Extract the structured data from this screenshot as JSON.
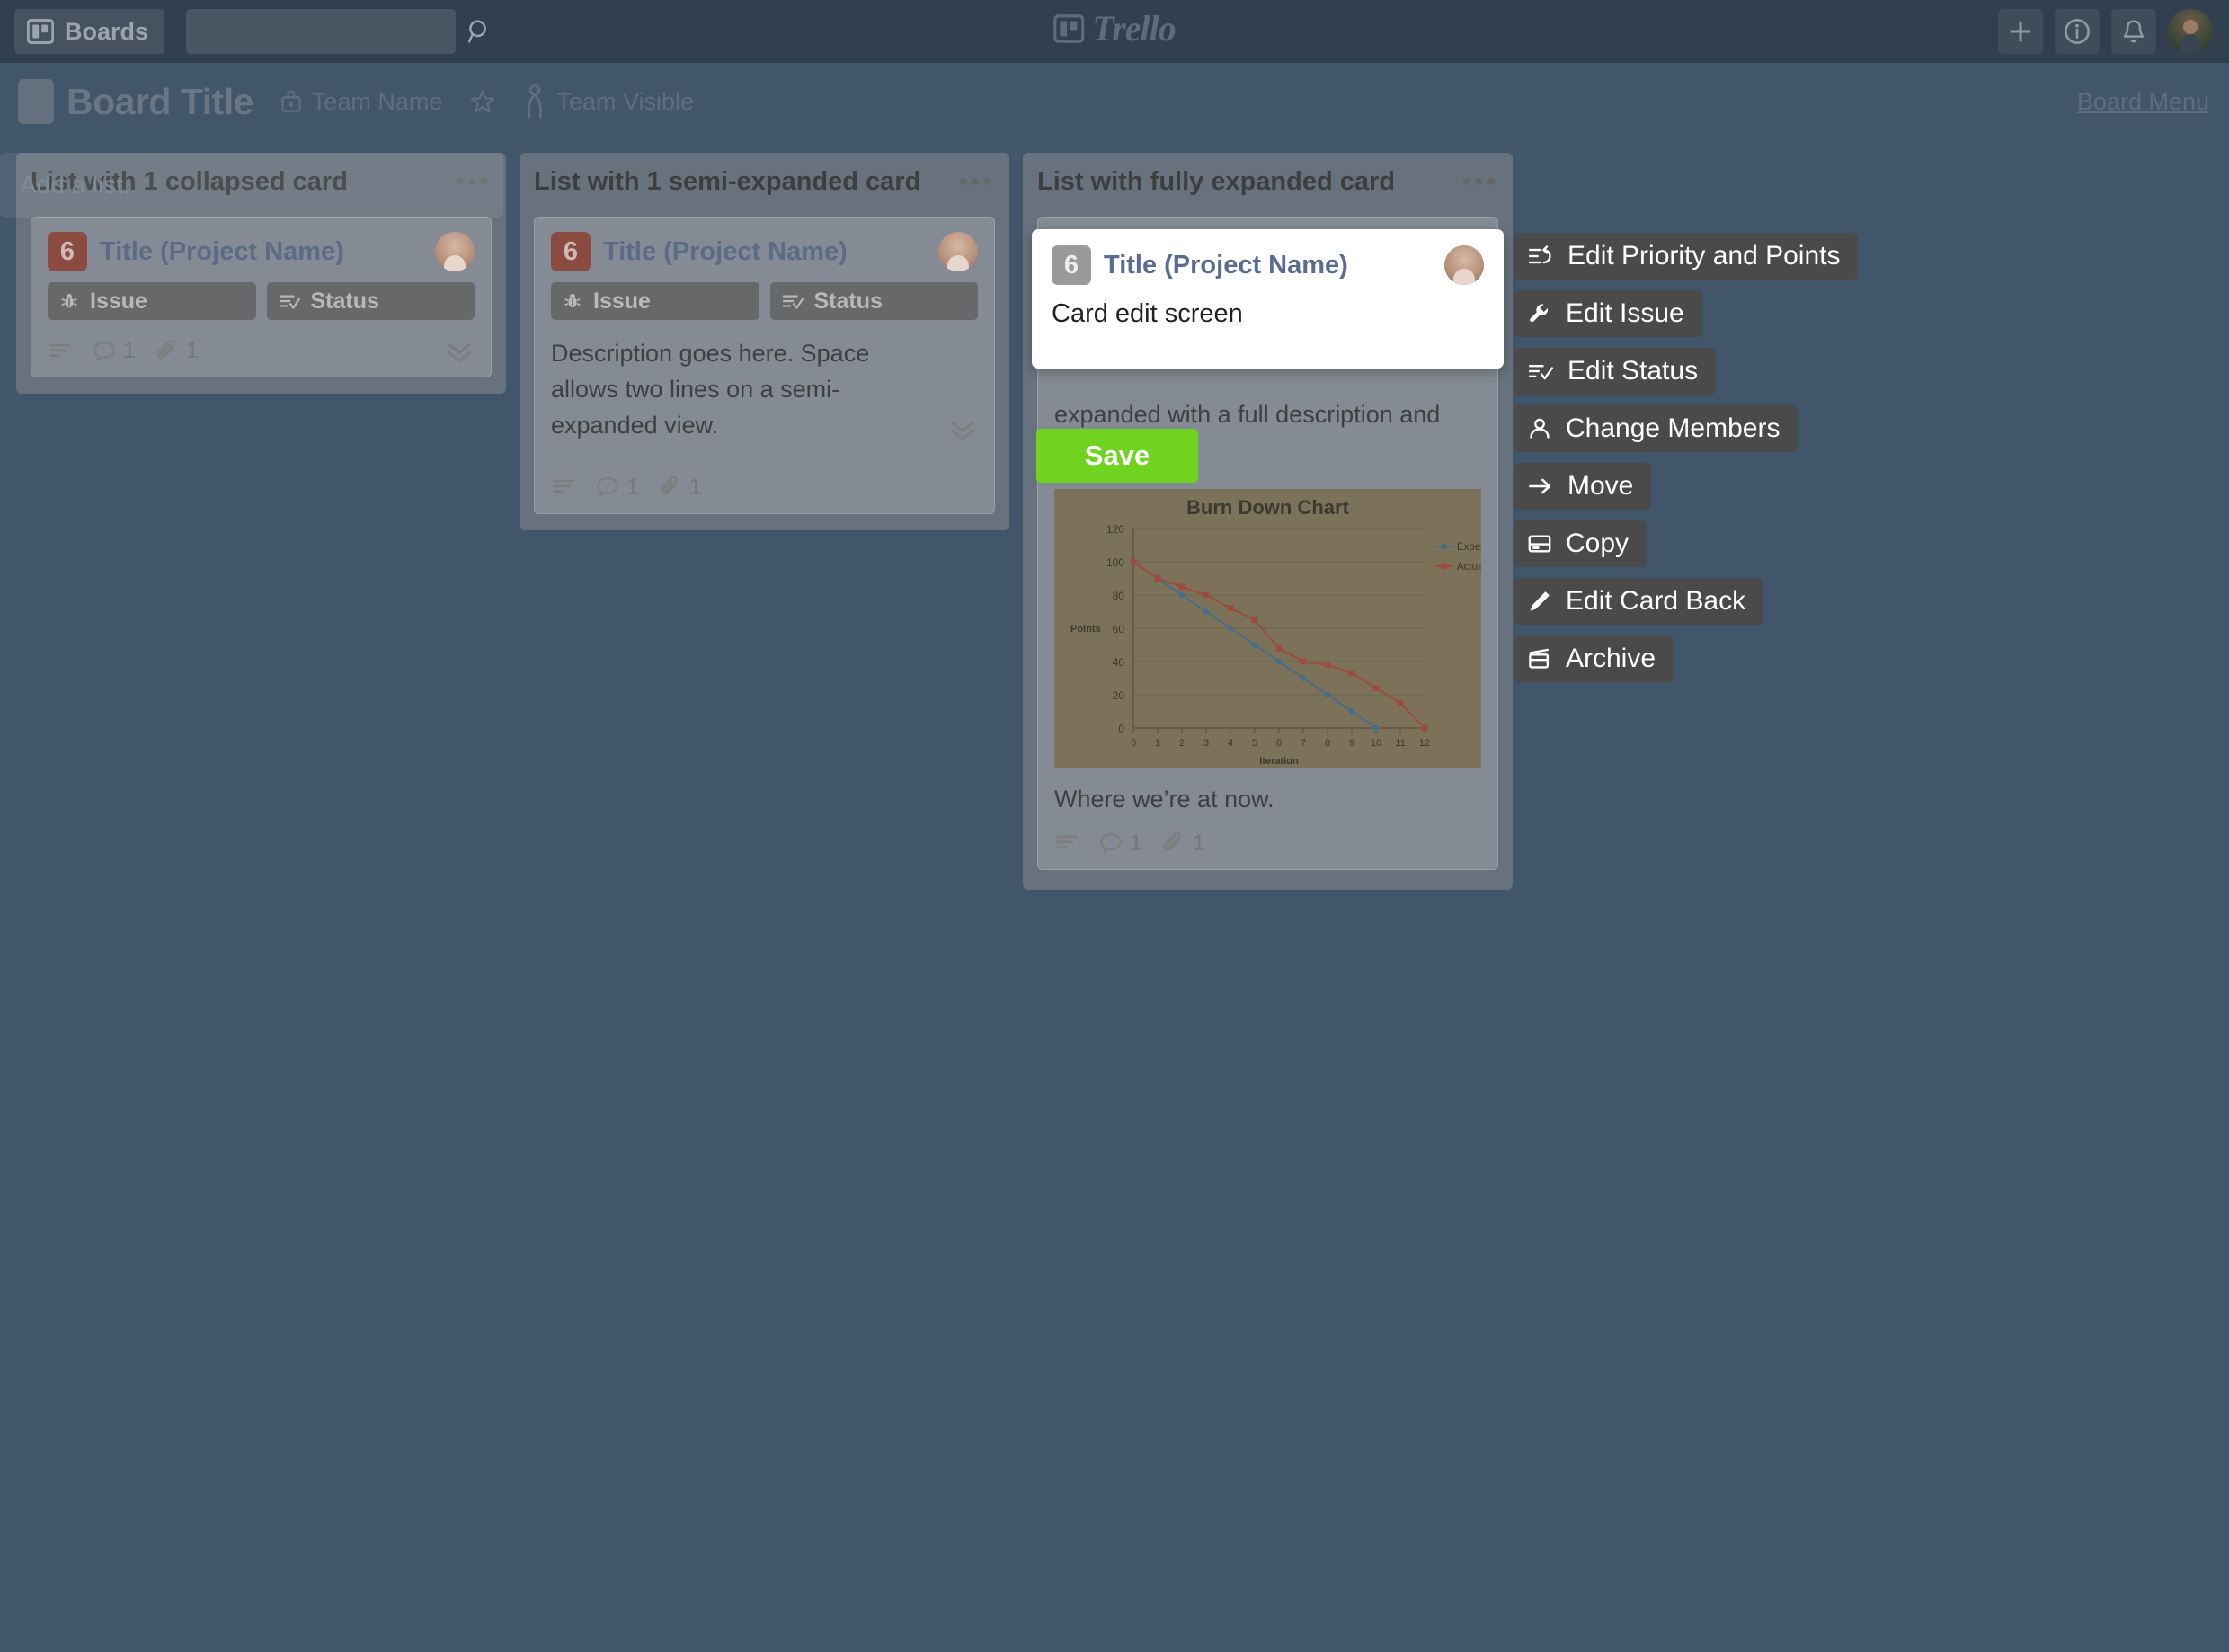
{
  "topbar": {
    "boards_label": "Boards",
    "search_placeholder": "",
    "search_value": "",
    "search_icon": "search-icon",
    "logo_text": "Trello",
    "icons": [
      "plus-icon",
      "info-icon",
      "bell-icon",
      "avatar"
    ]
  },
  "board_header": {
    "title": "Board Title",
    "team_name": "Team Name",
    "team_name_icon": "briefcase-lock-icon",
    "star_icon": "star-icon",
    "visibility": "Team Visible",
    "visibility_icon": "person-visible-icon",
    "board_menu": "Board Menu"
  },
  "lists": [
    {
      "title": "List with 1 collapsed card",
      "menu_icon": "ellipsis-icon",
      "card": {
        "points": "6",
        "title": "Title (Project Name)",
        "labels": [
          {
            "text": "Issue",
            "icon": "bug-icon"
          },
          {
            "text": "Status",
            "icon": "status-list-icon"
          }
        ],
        "description": "",
        "footer": {
          "description_icon": "description-icon",
          "comment_icon": "comment-icon",
          "comment_count": "1",
          "attachment_icon": "paperclip-icon",
          "attachment_count": "1",
          "expand_icon": "double-chevron-down-icon"
        }
      }
    },
    {
      "title": "List with 1 semi-expanded card",
      "menu_icon": "ellipsis-icon",
      "card": {
        "points": "6",
        "title": "Title (Project Name)",
        "labels": [
          {
            "text": "Issue",
            "icon": "bug-icon"
          },
          {
            "text": "Status",
            "icon": "status-list-icon"
          }
        ],
        "description": "Description goes here. Space allows two lines on a semi-expanded view.",
        "expand_icon": "double-chevron-down-icon",
        "footer": {
          "description_icon": "description-icon",
          "comment_icon": "comment-icon",
          "comment_count": "1",
          "attachment_icon": "paperclip-icon",
          "attachment_count": "1"
        }
      }
    },
    {
      "title": "List with fully expanded card",
      "menu_icon": "ellipsis-icon",
      "card": {
        "points": "6",
        "title": "Title (Project Name)",
        "description": "expanded with a full description and attachments.",
        "attachment_caption": "Where we’re at now.",
        "footer": {
          "description_icon": "description-icon",
          "comment_icon": "comment-icon",
          "comment_count": "1",
          "attachment_icon": "paperclip-icon",
          "attachment_count": "1"
        }
      }
    }
  ],
  "add_list": {
    "placeholder": "Add a list..."
  },
  "edit_overlay": {
    "points": "6",
    "title": "Title (Project Name)",
    "body_text": "Card edit screen",
    "save_label": "Save"
  },
  "context_menu": [
    {
      "label": "Edit Priority and Points",
      "icon": "priority-points-icon"
    },
    {
      "label": "Edit Issue",
      "icon": "wrench-icon"
    },
    {
      "label": "Edit Status",
      "icon": "status-list-icon"
    },
    {
      "label": "Change Members",
      "icon": "person-icon"
    },
    {
      "label": "Move",
      "icon": "arrow-right-icon"
    },
    {
      "label": "Copy",
      "icon": "copy-card-icon"
    },
    {
      "label": "Edit Card Back",
      "icon": "pencil-icon"
    },
    {
      "label": "Archive",
      "icon": "archive-box-icon"
    }
  ],
  "colors": {
    "board_background": "#41556b",
    "topbar": "#313f4e",
    "save_button": "#6fd320",
    "points_badge": "#8b4b41",
    "card_title": "#5c6b85",
    "chart_background": "#7c7259",
    "expected_series": "#4a6c86",
    "actual_series": "#9e4a3f"
  },
  "chart_data": {
    "type": "line",
    "title": "Burn Down Chart",
    "xlabel": "Iteration",
    "ylabel": "Points",
    "x": [
      0,
      1,
      2,
      3,
      4,
      5,
      6,
      7,
      8,
      9,
      10,
      11,
      12
    ],
    "xticks": [
      "0",
      "1",
      "2",
      "3",
      "4",
      "5",
      "6",
      "7",
      "8",
      "9",
      "10",
      "11",
      "12"
    ],
    "yticks": [
      "0",
      "20",
      "40",
      "60",
      "80",
      "100",
      "120"
    ],
    "ylim": [
      0,
      120
    ],
    "xlim": [
      0,
      12
    ],
    "grid": true,
    "legend_position": "right",
    "series": [
      {
        "name": "Expected",
        "color": "#4a6c86",
        "marker": "diamond",
        "x": [
          0,
          1,
          2,
          3,
          4,
          5,
          6,
          7,
          8,
          9,
          10
        ],
        "values": [
          100,
          90,
          80,
          70,
          60,
          50,
          40,
          30,
          20,
          10,
          0
        ]
      },
      {
        "name": "Actual",
        "color": "#9e4a3f",
        "marker": "square",
        "x": [
          0,
          1,
          2,
          3,
          4,
          5,
          6,
          7,
          8,
          9,
          10,
          11,
          12
        ],
        "values": [
          100,
          90,
          85,
          80,
          72,
          65,
          48,
          40,
          38,
          33,
          24,
          15,
          0
        ]
      }
    ]
  }
}
